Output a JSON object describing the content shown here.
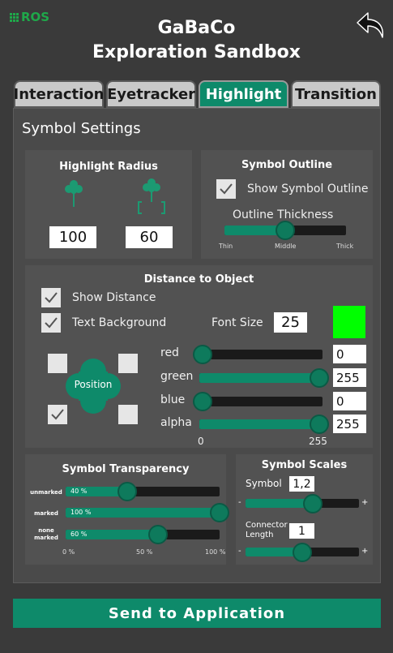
{
  "ros_label": "ROS",
  "title_line1": "GaBaCo",
  "title_line2": "Exploration Sandbox",
  "tabs": [
    {
      "label": "Interaction",
      "active": false
    },
    {
      "label": "Eyetracker",
      "active": false
    },
    {
      "label": "Highlight",
      "active": true
    },
    {
      "label": "Transition",
      "active": false
    }
  ],
  "section_title": "Symbol Settings",
  "highlight_radius": {
    "title": "Highlight Radius",
    "value_symbol": "100",
    "value_bracket": "60"
  },
  "symbol_outline": {
    "title": "Symbol Outline",
    "show_label": "Show Symbol Outline",
    "show_checked": true,
    "thickness_label": "Outline Thickness",
    "thickness_level": 0.5,
    "ticks": [
      "Thin",
      "Middle",
      "Thick"
    ]
  },
  "distance": {
    "title": "Distance to Object",
    "show_distance_label": "Show Distance",
    "show_distance_checked": true,
    "text_bg_label": "Text Background",
    "text_bg_checked": true,
    "font_size_label": "Font Size",
    "font_size_value": "25",
    "swatch_color": "#00ff00",
    "position_label": "Position",
    "position_checked": "bottom-left",
    "channels": [
      {
        "label": "red",
        "value": "0",
        "level": 0.0
      },
      {
        "label": "green",
        "value": "255",
        "level": 1.0
      },
      {
        "label": "blue",
        "value": "0",
        "level": 0.0
      },
      {
        "label": "alpha",
        "value": "255",
        "level": 1.0
      }
    ],
    "range_min": "0",
    "range_max": "255"
  },
  "transparency": {
    "title": "Symbol Transparency",
    "rows": [
      {
        "label": "unmarked",
        "value_text": "40 %",
        "level": 0.4
      },
      {
        "label": "marked",
        "value_text": "100 %",
        "level": 1.0
      },
      {
        "label_line1": "none",
        "label_line2": "marked",
        "value_text": "60 %",
        "level": 0.6
      }
    ],
    "ticks": [
      "0 %",
      "50 %",
      "100 %"
    ]
  },
  "scales": {
    "title": "Symbol Scales",
    "symbol_label": "Symbol",
    "symbol_value": "1,2",
    "symbol_level": 0.59,
    "connector_label_line1": "Connector",
    "connector_label_line2": "Length",
    "connector_value": "1",
    "connector_level": 0.5,
    "minus": "-",
    "plus": "+"
  },
  "send_button": "Send to Application",
  "accent_color": "#0e8a6a"
}
